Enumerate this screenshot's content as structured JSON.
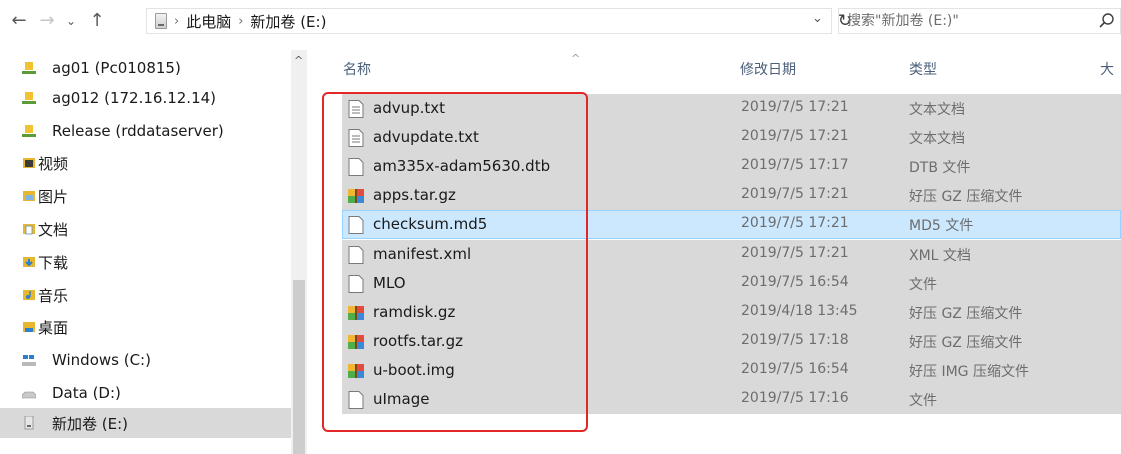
{
  "address_bar": {
    "back_icon": "arrow-left-icon",
    "forward_icon": "arrow-right-icon",
    "recent_icon": "chevron-down-icon",
    "up_icon": "arrow-up-icon",
    "breadcrumb": [
      "此电脑",
      "新加卷 (E:)"
    ],
    "refresh_icon": "refresh-icon",
    "search_placeholder": "搜索\"新加卷 (E:)\""
  },
  "nav_pane": {
    "items": [
      {
        "label": "ag01 (Pc010815)",
        "icon": "network-drive-icon"
      },
      {
        "label": "ag012 (172.16.12.14)",
        "icon": "network-drive-icon"
      },
      {
        "label": "Release (rddataserver)",
        "icon": "network-drive-icon"
      },
      {
        "label": "视频",
        "icon": "videos-folder-icon"
      },
      {
        "label": "图片",
        "icon": "pictures-folder-icon"
      },
      {
        "label": "文档",
        "icon": "documents-folder-icon"
      },
      {
        "label": "下载",
        "icon": "downloads-folder-icon"
      },
      {
        "label": "音乐",
        "icon": "music-folder-icon"
      },
      {
        "label": "桌面",
        "icon": "desktop-folder-icon"
      },
      {
        "label": "Windows (C:)",
        "icon": "windows-drive-icon"
      },
      {
        "label": "Data (D:)",
        "icon": "drive-icon"
      },
      {
        "label": "新加卷 (E:)",
        "icon": "drive-icon",
        "selected": true
      }
    ]
  },
  "file_list": {
    "columns": {
      "name": "名称",
      "modified": "修改日期",
      "type": "类型",
      "size": "大"
    },
    "files": [
      {
        "name": "advup.txt",
        "modified": "2019/7/5 17:21",
        "type": "文本文档",
        "icon": "text-file-icon"
      },
      {
        "name": "advupdate.txt",
        "modified": "2019/7/5 17:21",
        "type": "文本文档",
        "icon": "text-file-icon"
      },
      {
        "name": "am335x-adam5630.dtb",
        "modified": "2019/7/5 17:17",
        "type": "DTB 文件",
        "icon": "file-icon"
      },
      {
        "name": "apps.tar.gz",
        "modified": "2019/7/5 17:21",
        "type": "好压 GZ 压缩文件",
        "icon": "archive-icon"
      },
      {
        "name": "checksum.md5",
        "modified": "2019/7/5 17:21",
        "type": "MD5 文件",
        "icon": "file-icon",
        "selected": true
      },
      {
        "name": "manifest.xml",
        "modified": "2019/7/5 17:21",
        "type": "XML 文档",
        "icon": "file-icon"
      },
      {
        "name": "MLO",
        "modified": "2019/7/5 16:54",
        "type": "文件",
        "icon": "file-icon"
      },
      {
        "name": "ramdisk.gz",
        "modified": "2019/4/18 13:45",
        "type": "好压 GZ 压缩文件",
        "icon": "archive-icon"
      },
      {
        "name": "rootfs.tar.gz",
        "modified": "2019/7/5 17:18",
        "type": "好压 GZ 压缩文件",
        "icon": "archive-icon"
      },
      {
        "name": "u-boot.img",
        "modified": "2019/7/5 16:54",
        "type": "好压 IMG 压缩文件",
        "icon": "archive-icon"
      },
      {
        "name": "uImage",
        "modified": "2019/7/5 17:16",
        "type": "文件",
        "icon": "file-icon"
      }
    ]
  },
  "colors": {
    "highlight_box": "#e32727",
    "selected_row": "#cce8ff",
    "row_gray": "#d9d9d9",
    "header_text": "#4c607a"
  }
}
